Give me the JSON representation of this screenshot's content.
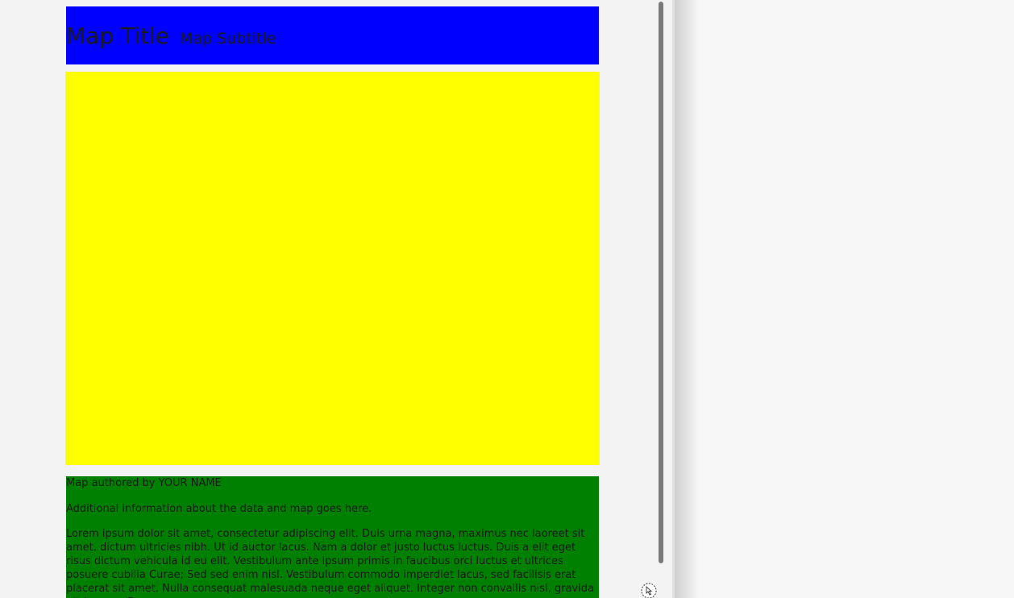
{
  "header": {
    "title": "Map Title",
    "subtitle": "Map Subtitle",
    "background_color": "#0000ff"
  },
  "map": {
    "background_color": "#ffff00"
  },
  "footer": {
    "background_color": "#008000",
    "author": "Map authored by YOUR NAME",
    "info": "Additional information about the data and map goes here.",
    "lorem": "Lorem ipsum dolor sit amet, consectetur adipiscing elit. Duis urna magna, maximus nec laoreet sit amet, dictum ultricies nibh. Ut id auctor lacus. Nam a dolor et justo luctus luctus. Duis a elit eget risus dictum vehicula id eu elit. Vestibulum ante ipsum primis in faucibus orci luctus et ultrices posuere cubilia Curae; Sed sed enim nisl. Vestibulum commodo imperdiet lacus, sed facilisis erat placerat sit amet. Nulla consequat malesuada neque eget aliquet. Integer non convallis nisl, gravida ultrices ex. Fusce nec"
  },
  "cursor": {
    "icon": "wait-cursor-icon"
  }
}
